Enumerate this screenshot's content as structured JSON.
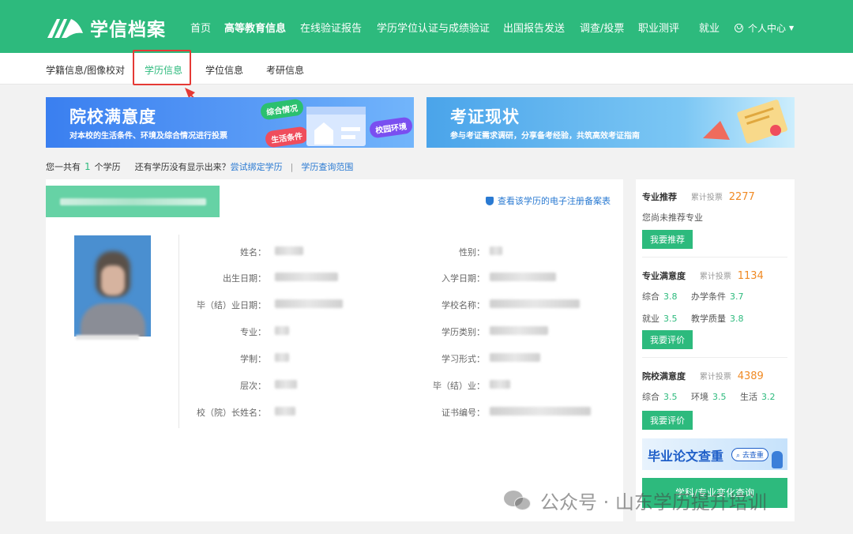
{
  "brand": {
    "name": "学信档案"
  },
  "nav": {
    "items": [
      "首页",
      "高等教育信息",
      "在线验证报告",
      "学历学位认证与成绩验证",
      "出国报告发送",
      "调查/投票",
      "职业测评",
      "就业"
    ],
    "personal": "个人中心"
  },
  "subnav": {
    "items": [
      "学籍信息/图像校对",
      "学历信息",
      "学位信息",
      "考研信息"
    ]
  },
  "banner1": {
    "title": "院校满意度",
    "subtitle": "对本校的生活条件、环境及综合情况进行投票",
    "tags": [
      "综合情况",
      "生活条件",
      "校园环境"
    ]
  },
  "banner2": {
    "title": "考证现状",
    "subtitle": "参与考证需求调研，分享备考经验，共筑高效考证指南"
  },
  "summary": {
    "prefix": "您一共有",
    "count": "1",
    "suffix": "个学历",
    "question": "还有学历没有显示出来？",
    "bind_link": "尝试绑定学历",
    "range_link": "学历查询范围"
  },
  "record": {
    "link": "查看该学历的电子注册备案表",
    "fields_left": [
      "姓名：",
      "出生日期：",
      "毕（结）业日期：",
      "专业：",
      "学制：",
      "层次：",
      "校（院）长姓名："
    ],
    "fields_right": [
      "性别：",
      "入学日期：",
      "学校名称：",
      "学历类别：",
      "学习形式：",
      "毕（结）业：",
      "证书编号："
    ]
  },
  "sidebar": {
    "major_rec": {
      "title": "专业推荐",
      "vote_label": "累计投票",
      "votes": "2277",
      "text": "您尚未推荐专业",
      "button": "我要推荐"
    },
    "major_sat": {
      "title": "专业满意度",
      "vote_label": "累计投票",
      "votes": "1134",
      "s1_label": "综合",
      "s1": "3.8",
      "s2_label": "办学条件",
      "s2": "3.7",
      "s3_label": "就业",
      "s3": "3.5",
      "s4_label": "教学质量",
      "s4": "3.8",
      "button": "我要评价"
    },
    "school_sat": {
      "title": "院校满意度",
      "vote_label": "累计投票",
      "votes": "4389",
      "s1_label": "综合",
      "s1": "3.5",
      "s2_label": "环境",
      "s2": "3.5",
      "s3_label": "生活",
      "s3": "3.2",
      "button": "我要评价"
    },
    "promo": {
      "title": "毕业论文查重",
      "button": "去查重"
    },
    "query_button": "学科/专业变化查询"
  },
  "watermark": {
    "text": "公众号 · 山东学历提升培训"
  },
  "colors": {
    "brand": "#2dba7d",
    "link": "#2a7ad2",
    "votes": "#f08a24",
    "highlight": "#e53935"
  }
}
